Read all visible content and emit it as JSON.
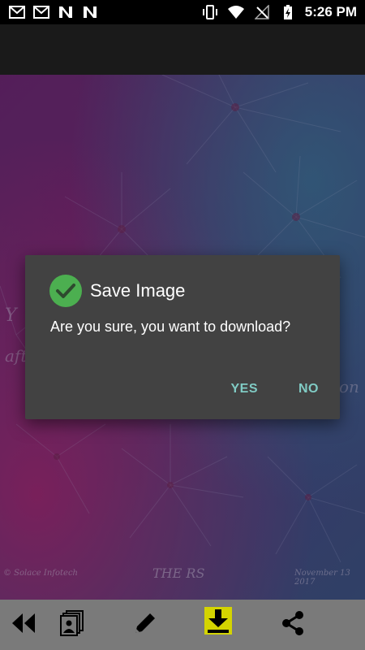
{
  "status_bar": {
    "time": "5:26 PM",
    "left_icons": [
      "gmail-icon",
      "gmail-icon",
      "n-notification-icon",
      "n-notification-icon"
    ],
    "right_icons": [
      "vibrate-icon",
      "wifi-icon",
      "no-signal-icon",
      "battery-charging-icon"
    ]
  },
  "image": {
    "quote_fragments": [
      "Y",
      "afte",
      "on"
    ],
    "footer_left": "© Solace Infotech",
    "footer_center": "THE RS",
    "footer_right": "November 13 2017"
  },
  "dialog": {
    "icon": "check-circle-icon",
    "title": "Save Image",
    "message": "Are you sure, you want to download?",
    "yes_label": "YES",
    "no_label": "NO",
    "accent_color": "#80cbc4",
    "icon_color": "#4caf50"
  },
  "bottom_bar": {
    "icons": [
      "rewind-icon",
      "gallery-icon",
      "edit-icon",
      "download-icon",
      "share-icon"
    ],
    "download_highlight_color": "#d4d400"
  }
}
